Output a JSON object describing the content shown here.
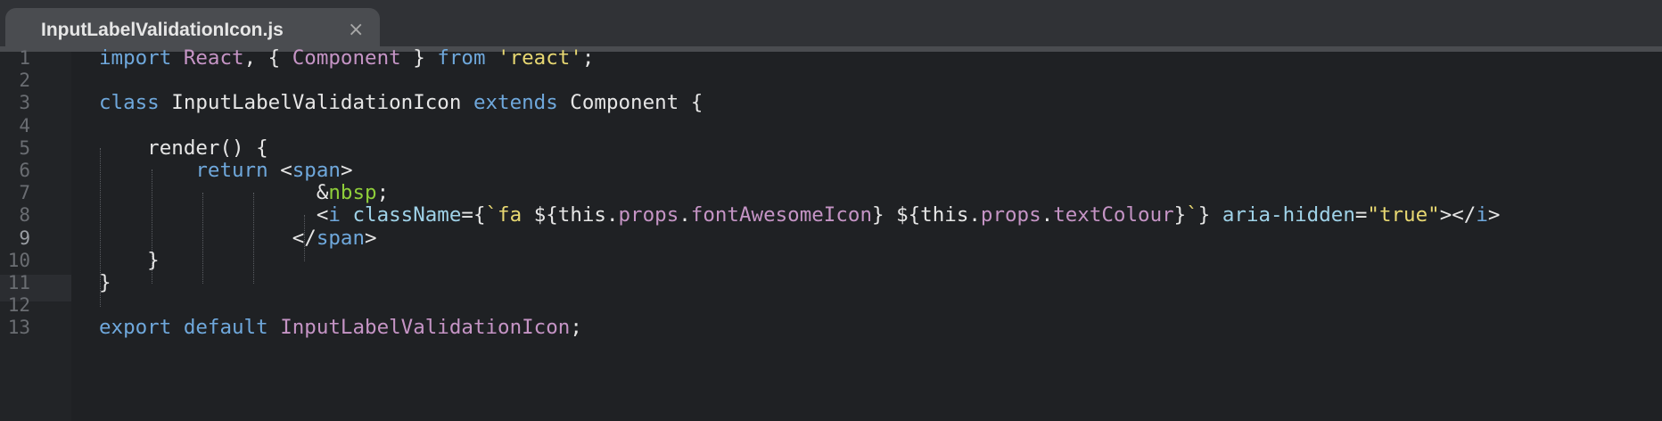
{
  "tab": {
    "title": "InputLabelValidationIcon.js",
    "close": "×"
  },
  "gutter": {
    "line_numbers": [
      "1",
      "2",
      "3",
      "4",
      "5",
      "6",
      "7",
      "8",
      "9",
      "10",
      "11",
      "12",
      "13"
    ],
    "current_line": "9"
  },
  "code": {
    "l1": [
      "import",
      " ",
      "React",
      ", { ",
      "Component",
      " } ",
      "from",
      " ",
      "'react'",
      ";"
    ],
    "l3": [
      "class",
      " InputLabelValidationIcon ",
      "extends",
      " Component {"
    ],
    "l5": [
      "    render() {"
    ],
    "l6": [
      "        ",
      "return",
      " <",
      "span",
      ">"
    ],
    "l7": [
      "                  &",
      "nbsp",
      ";"
    ],
    "l8": [
      "                  <",
      "i",
      " ",
      "className",
      "={",
      "`",
      "fa ",
      "${this.",
      "props",
      ".",
      "fontAwesomeIcon",
      "} ${this.",
      "props",
      ".",
      "textColour",
      "}",
      "`",
      "} ",
      "aria-hidden",
      "=",
      "\"true\"",
      "></",
      "i",
      ">"
    ],
    "l9": [
      "                </",
      "span",
      ">"
    ],
    "l10": [
      "    }"
    ],
    "l11": [
      "}"
    ],
    "l13": [
      "export",
      " ",
      "default",
      " ",
      "InputLabelValidationIcon",
      ";"
    ]
  }
}
